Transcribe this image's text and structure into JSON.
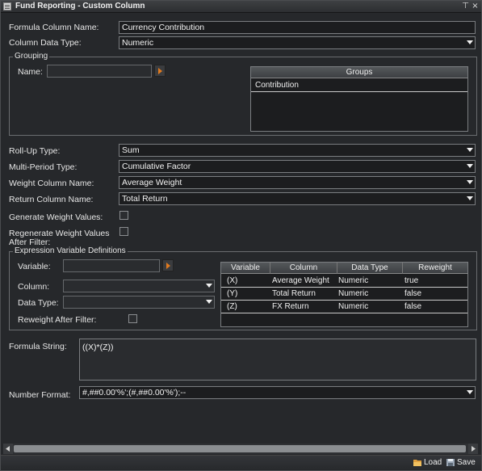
{
  "window": {
    "title": "Fund Reporting - Custom Column",
    "pin_glyph": "⊤",
    "close_glyph": "×"
  },
  "form": {
    "formula_column_name_label": "Formula Column Name:",
    "formula_column_name_value": "Currency Contribution",
    "column_data_type_label": "Column Data Type:",
    "column_data_type_value": "Numeric",
    "rollup_type_label": "Roll-Up Type:",
    "rollup_type_value": "Sum",
    "multi_period_type_label": "Multi-Period Type:",
    "multi_period_type_value": "Cumulative Factor",
    "weight_column_name_label": "Weight Column Name:",
    "weight_column_name_value": "Average Weight",
    "return_column_name_label": "Return Column Name:",
    "return_column_name_value": "Total Return",
    "generate_weight_values_label": "Generate Weight Values:",
    "generate_weight_values_checked": false,
    "regenerate_weight_values_label_1": "Regenerate Weight Values",
    "regenerate_weight_values_label_2": "After Filter:",
    "regenerate_weight_values_checked": false,
    "formula_string_label": "Formula String:",
    "formula_string_value": "((X)*(Z))",
    "number_format_label": "Number Format:",
    "number_format_value": "#,##0.00'%';(#,##0.00'%');--"
  },
  "grouping": {
    "title": "Grouping",
    "name_label": "Name:",
    "name_value": "",
    "groups_header": "Groups",
    "groups": [
      "Contribution"
    ]
  },
  "expression": {
    "title": "Expression Variable Definitions",
    "variable_label": "Variable:",
    "variable_value": "",
    "column_label": "Column:",
    "column_value": "",
    "data_type_label": "Data Type:",
    "data_type_value": "",
    "reweight_label": "Reweight After Filter:",
    "reweight_checked": false,
    "table": {
      "headers": [
        "Variable",
        "Column",
        "Data Type",
        "Reweight"
      ],
      "rows": [
        [
          "(X)",
          "Average Weight",
          "Numeric",
          "true"
        ],
        [
          "(Y)",
          "Total Return",
          "Numeric",
          "false"
        ],
        [
          "(Z)",
          "FX Return",
          "Numeric",
          "false"
        ]
      ]
    }
  },
  "footer": {
    "load_label": "Load",
    "save_label": "Save"
  },
  "icons": {
    "dropdown": "chevron-down-icon",
    "go": "arrow-right-icon",
    "load": "folder-icon",
    "save": "disk-icon"
  },
  "colors": {
    "background": "#26282b",
    "field": "#1c1d1f",
    "accent_orange": "#e07a1f"
  }
}
